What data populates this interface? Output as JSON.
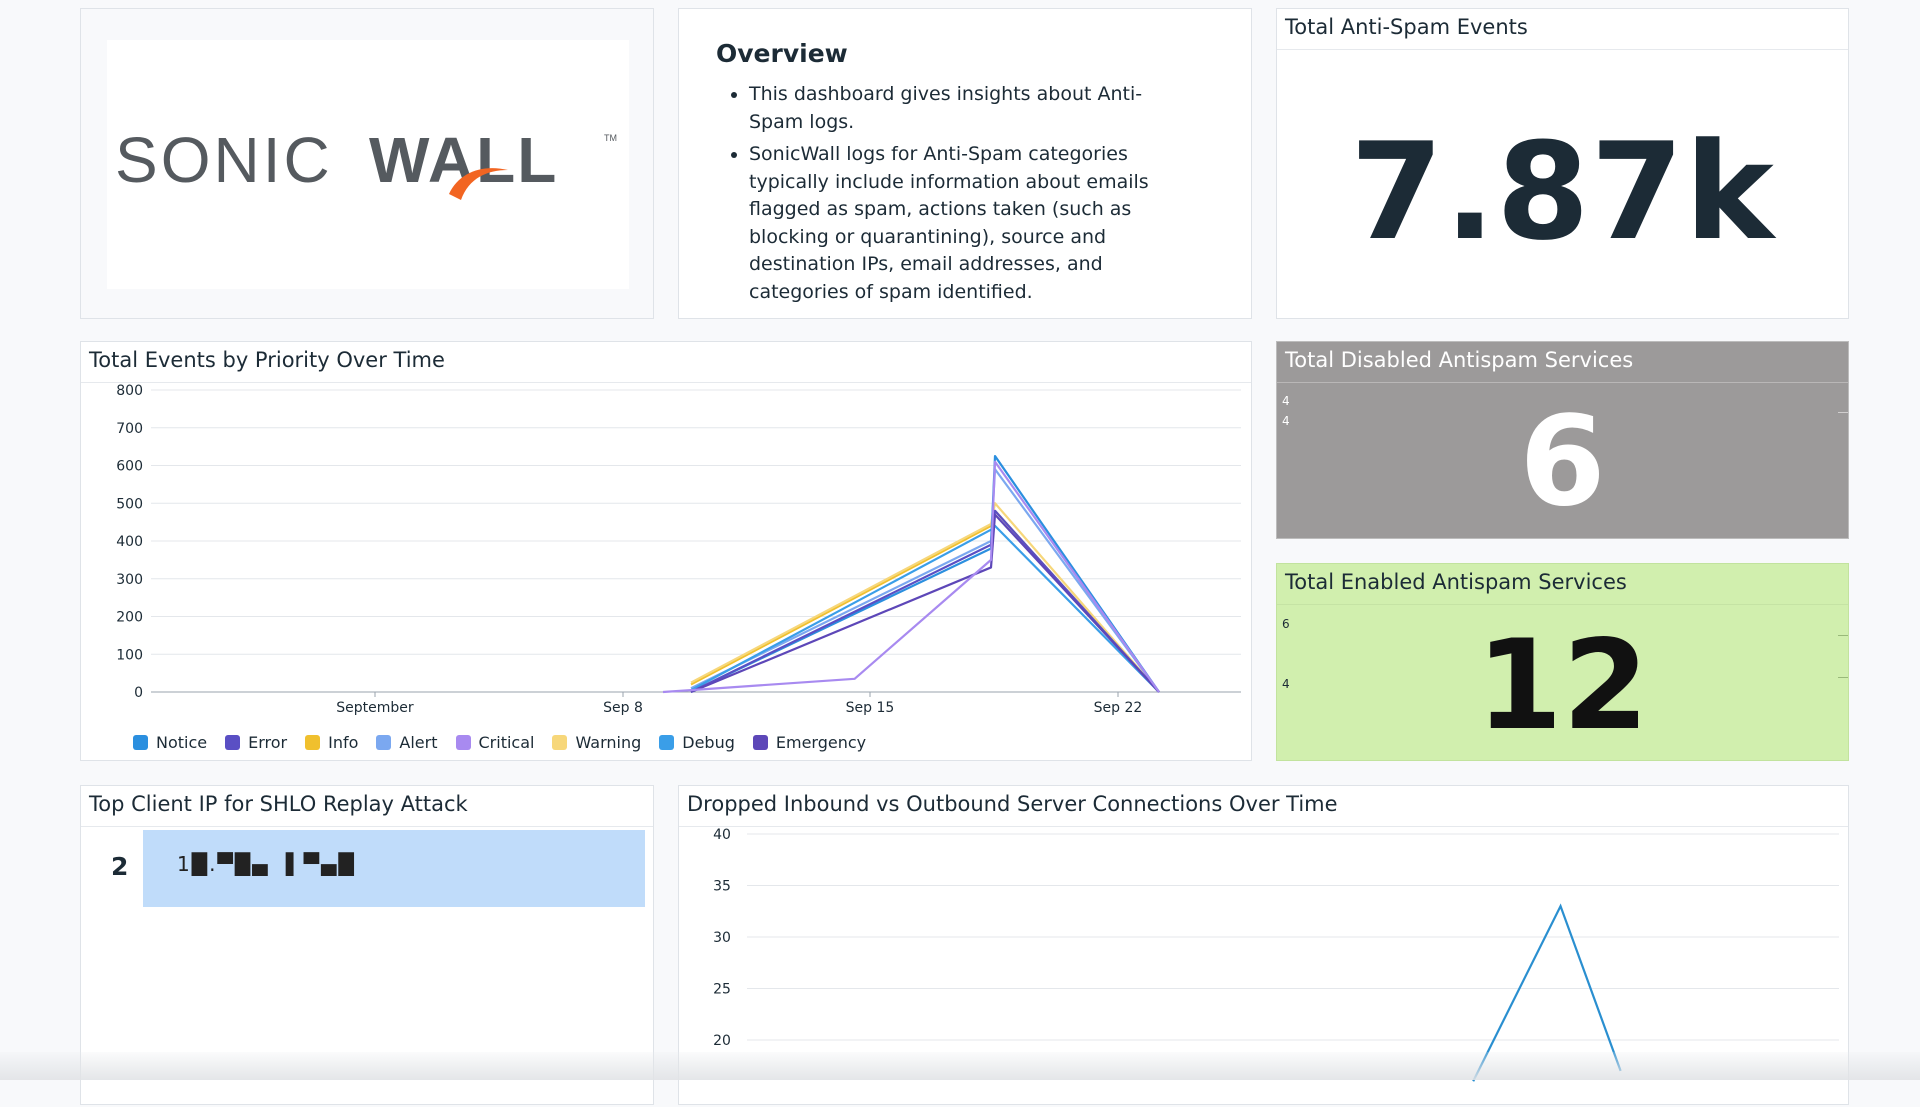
{
  "logo": {
    "text_sonic": "SONIC",
    "text_wall": "WALL",
    "tm": "TM"
  },
  "overview": {
    "heading": "Overview",
    "bullets": [
      "This dashboard gives insights about Anti-Spam logs.",
      "SonicWall logs for Anti-Spam categories typically include information about emails flagged as spam, actions taken (such as blocking or quarantining), source and destination IPs, email addresses, and categories of spam identified."
    ]
  },
  "stat_total": {
    "title": "Total Anti-Spam Events",
    "value": "7.87k"
  },
  "stat_disabled": {
    "title": "Total Disabled Antispam Services",
    "value": "6",
    "spark_labels": [
      "4",
      "4"
    ],
    "bg_color": "#9c9a9a"
  },
  "stat_enabled": {
    "title": "Total Enabled Antispam Services",
    "value": "12",
    "spark_labels": [
      "6",
      "4"
    ],
    "bg_color": "#d1efae"
  },
  "priority_chart": {
    "title": "Total Events by Priority Over Time",
    "y_ticks": [
      "0",
      "100",
      "200",
      "300",
      "400",
      "500",
      "600",
      "700",
      "800"
    ],
    "x_ticks": [
      "September",
      "Sep 8",
      "Sep 15",
      "Sep 22"
    ],
    "legend": [
      {
        "label": "Notice",
        "color": "#2b8fdf"
      },
      {
        "label": "Error",
        "color": "#5a4fc4"
      },
      {
        "label": "Info",
        "color": "#f0c02e"
      },
      {
        "label": "Alert",
        "color": "#7ba8f0"
      },
      {
        "label": "Critical",
        "color": "#a88af0"
      },
      {
        "label": "Warning",
        "color": "#f7d77a"
      },
      {
        "label": "Debug",
        "color": "#3a9ee8"
      },
      {
        "label": "Emergency",
        "color": "#5d47b8"
      }
    ]
  },
  "chart_data": [
    {
      "type": "line",
      "title": "Total Events by Priority Over Time",
      "ylim": [
        0,
        800
      ],
      "x_ticks": [
        "September",
        "Sep 8",
        "Sep 15",
        "Sep 22"
      ],
      "x_domain_days": [
        0,
        25
      ],
      "series": [
        {
          "name": "Info",
          "color": "#f0c02e",
          "points": [
            [
              12,
              20
            ],
            [
              20.8,
              440
            ],
            [
              20.9,
              480
            ],
            [
              26.3,
              0
            ]
          ]
        },
        {
          "name": "Warning",
          "color": "#f7d77a",
          "points": [
            [
              12,
              25
            ],
            [
              20.8,
              445
            ],
            [
              20.9,
              500
            ],
            [
              26.3,
              0
            ]
          ]
        },
        {
          "name": "Alert",
          "color": "#7ba8f0",
          "points": [
            [
              12,
              10
            ],
            [
              20.8,
              400
            ],
            [
              20.9,
              590
            ],
            [
              26.3,
              0
            ]
          ]
        },
        {
          "name": "Debug",
          "color": "#3a9ee8",
          "points": [
            [
              12,
              5
            ],
            [
              20.8,
              430
            ],
            [
              20.9,
              440
            ],
            [
              26.3,
              0
            ]
          ]
        },
        {
          "name": "Notice",
          "color": "#2b8fdf",
          "points": [
            [
              12,
              0
            ],
            [
              20.8,
              380
            ],
            [
              20.9,
              625
            ],
            [
              26.3,
              0
            ]
          ]
        },
        {
          "name": "Error",
          "color": "#5a4fc4",
          "points": [
            [
              12,
              0
            ],
            [
              20.8,
              390
            ],
            [
              20.9,
              480
            ],
            [
              26.3,
              0
            ]
          ]
        },
        {
          "name": "Emergency",
          "color": "#5d47b8",
          "points": [
            [
              12,
              0
            ],
            [
              20.8,
              330
            ],
            [
              20.9,
              470
            ],
            [
              26.3,
              0
            ]
          ]
        },
        {
          "name": "Critical",
          "color": "#a88af0",
          "points": [
            [
              11,
              0
            ],
            [
              12,
              5
            ],
            [
              16.8,
              35
            ],
            [
              20.8,
              350
            ],
            [
              20.9,
              610
            ],
            [
              26.3,
              0
            ]
          ]
        }
      ]
    },
    {
      "type": "line",
      "title": "Dropped Inbound vs Outbound Server Connections Over Time",
      "ylim": [
        20,
        40
      ],
      "y_ticks": [
        "40",
        "35",
        "30",
        "25",
        "20"
      ],
      "series": [
        {
          "name": "",
          "color": "#2a8fd0",
          "points": [
            [
              0.665,
              16
            ],
            [
              0.745,
              33
            ],
            [
              0.8,
              17
            ]
          ]
        }
      ]
    }
  ],
  "top_ip": {
    "title": "Top Client IP for SHLO Replay Attack",
    "rank": "2",
    "value": "1█.▀█▄ ▐ ▀▄█"
  },
  "dropped_chart": {
    "title": "Dropped Inbound vs Outbound Server Connections Over Time",
    "y_ticks": [
      "40",
      "35",
      "30",
      "25",
      "20"
    ]
  }
}
